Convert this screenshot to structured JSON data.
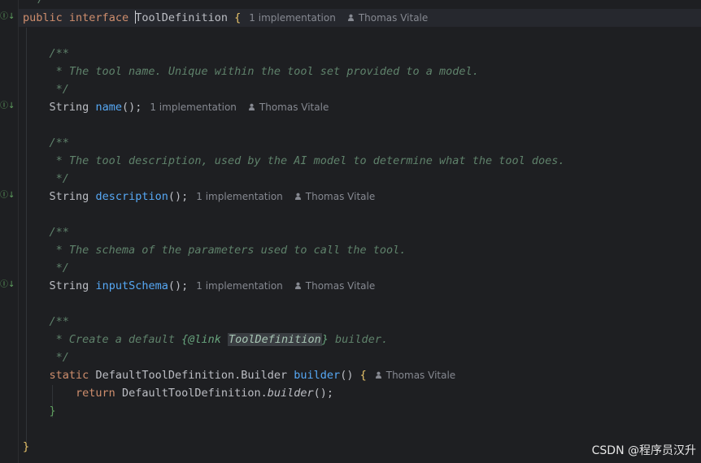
{
  "code": {
    "top_fragment": "*/",
    "interface_kw1": "public",
    "interface_kw2": "interface",
    "interface_name": "ToolDefinition",
    "open_brace": "{",
    "close_brace": "}",
    "doc_open": "/**",
    "doc_close": "*/",
    "doc_name": " * The tool name. Unique within the tool set provided to a model.",
    "doc_description": " * The tool description, used by the AI model to determine what the tool does.",
    "doc_schema": " * The schema of the parameters used to call the tool.",
    "doc_default_prefix": " * Create a default ",
    "doc_link_open": "{@link ",
    "doc_link_target": "ToolDefinition",
    "doc_link_close": "}",
    "doc_default_suffix": " builder.",
    "type_string": "String",
    "method_name": "name",
    "method_description": "description",
    "method_input_schema": "inputSchema",
    "call_parens": "()",
    "semicolon": ";",
    "static_kw": "static",
    "builder_type": "DefaultToolDefinition.Builder",
    "builder_method": "builder",
    "return_kw": "return",
    "return_target": "DefaultToolDefinition.",
    "return_call": "builder",
    "return_tail": "();"
  },
  "hints": {
    "implementations": "1 implementation",
    "author": "Thomas Vitale"
  },
  "gutter": {
    "impl_icon": "implemented-down-arrow-icon",
    "impl_glyph": "Ⓘ↓"
  },
  "watermark": "CSDN @程序员汉升",
  "colors": {
    "background": "#1e1f22",
    "keyword": "#cf8e6d",
    "function": "#56a8f5",
    "doc_comment": "#5f826b",
    "hint": "#868991"
  }
}
